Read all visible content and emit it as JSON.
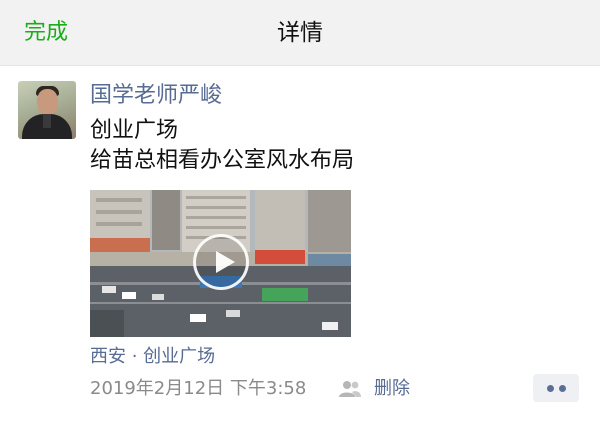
{
  "navbar": {
    "done_label": "完成",
    "title": "详情"
  },
  "post": {
    "author": "国学老师严峻",
    "lines": [
      "创业广场",
      "给苗总相看办公室风水布局"
    ],
    "location": "西安 · 创业广场",
    "timestamp": "2019年2月12日 下午3:58",
    "delete_label": "删除"
  },
  "icons": {
    "avatar": "avatar-photo",
    "video": "play-icon",
    "visibility": "people-icon",
    "more": "more-dots-icon"
  },
  "colors": {
    "accent_green": "#1aad19",
    "link_blue": "#576b95",
    "navbar_bg": "#f2f2f2",
    "meta_gray": "#8a8a8a"
  }
}
